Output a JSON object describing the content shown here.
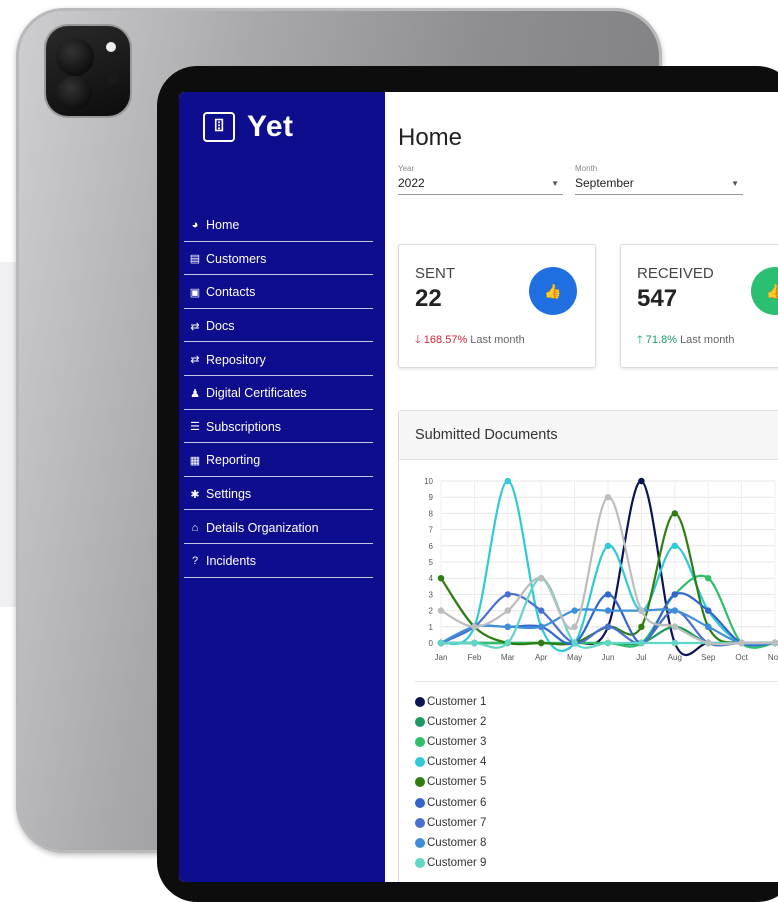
{
  "app": {
    "logo_text": "Yet",
    "logo_mark": "ꘖ"
  },
  "sidebar": {
    "items": [
      {
        "label": "Home",
        "icon": "dashboard-icon",
        "glyph": "◕"
      },
      {
        "label": "Customers",
        "icon": "id-card-icon",
        "glyph": "▤"
      },
      {
        "label": "Contacts",
        "icon": "contact-book-icon",
        "glyph": "▣"
      },
      {
        "label": "Docs",
        "icon": "exchange-arrows-icon",
        "glyph": "⇄"
      },
      {
        "label": "Repository",
        "icon": "exchange-arrows-icon",
        "glyph": "⇄"
      },
      {
        "label": "Digital Certificates",
        "icon": "user-stamp-icon",
        "glyph": "♟"
      },
      {
        "label": "Subscriptions",
        "icon": "list-icon",
        "glyph": "☰"
      },
      {
        "label": "Reporting",
        "icon": "calendar-icon",
        "glyph": "▦"
      },
      {
        "label": "Settings",
        "icon": "gear-icon",
        "glyph": "✱"
      },
      {
        "label": "Details Organization",
        "icon": "home-icon",
        "glyph": "⌂"
      },
      {
        "label": "Incidents",
        "icon": "question-icon",
        "glyph": "?"
      }
    ]
  },
  "main": {
    "title": "Home",
    "filters": {
      "year": {
        "label": "Year",
        "value": "2022"
      },
      "month": {
        "label": "Month",
        "value": "September"
      }
    },
    "kpis": {
      "sent": {
        "label": "SENT",
        "value": "22",
        "trend_arrow": "🡓",
        "trend_value": "168.57%",
        "trend_text": "Last month",
        "color": "#1f6fe0",
        "trend_color": "#d0263a"
      },
      "received": {
        "label": "RECEIVED",
        "value": "547",
        "trend_arrow": "🡑",
        "trend_value": "71.8%",
        "trend_text": "Last month",
        "color": "#2bbf72",
        "trend_color": "#1a9a63"
      }
    },
    "chart_title": "Submitted Documents"
  },
  "chart_data": {
    "type": "line",
    "categories": [
      "Jan",
      "Feb",
      "Mar",
      "Apr",
      "May",
      "Jun",
      "Jul",
      "Aug",
      "Sep",
      "Oct",
      "Nov"
    ],
    "ylim": [
      0,
      10
    ],
    "yticks": [
      0,
      1,
      2,
      3,
      4,
      5,
      6,
      7,
      8,
      9,
      10
    ],
    "grid": true,
    "legend_position": "bottom",
    "series": [
      {
        "name": "Customer 1",
        "color": "#0b1454",
        "values": [
          0,
          0,
          0,
          0,
          0,
          1,
          10,
          0,
          0,
          0,
          0
        ]
      },
      {
        "name": "Customer 2",
        "color": "#1a9a63",
        "values": [
          0,
          0,
          0,
          0,
          0,
          0,
          0,
          1,
          0,
          0,
          0
        ]
      },
      {
        "name": "Customer 3",
        "color": "#2fbf6b",
        "values": [
          0,
          0,
          0,
          0,
          0,
          0,
          0,
          3,
          4,
          0,
          0
        ]
      },
      {
        "name": "Customer 4",
        "color": "#30c9d6",
        "values": [
          0,
          1,
          10,
          1,
          0,
          6,
          2,
          6,
          2,
          0,
          0
        ]
      },
      {
        "name": "Customer 5",
        "color": "#2d7d10",
        "values": [
          4,
          1,
          0,
          0,
          0,
          1,
          1,
          8,
          1,
          0,
          0
        ]
      },
      {
        "name": "Customer 6",
        "color": "#3366cc",
        "values": [
          0,
          1,
          1,
          1,
          0,
          3,
          0,
          3,
          2,
          0,
          0
        ]
      },
      {
        "name": "Customer 7",
        "color": "#4a6fd0",
        "values": [
          0,
          1,
          3,
          2,
          0,
          1,
          0,
          2,
          0,
          0,
          0
        ]
      },
      {
        "name": "Customer 8",
        "color": "#3f8fd8",
        "values": [
          0,
          1,
          1,
          1,
          2,
          2,
          2,
          2,
          1,
          0,
          0
        ]
      },
      {
        "name": "Customer 9",
        "color": "#5fd6c6",
        "values": [
          0,
          0,
          0,
          4,
          0,
          0,
          0,
          0,
          0,
          0,
          0
        ]
      },
      {
        "name": "",
        "color": "#bdbdbd",
        "values": [
          2,
          1,
          2,
          4,
          1,
          9,
          2,
          1,
          0,
          0,
          0
        ]
      }
    ]
  }
}
